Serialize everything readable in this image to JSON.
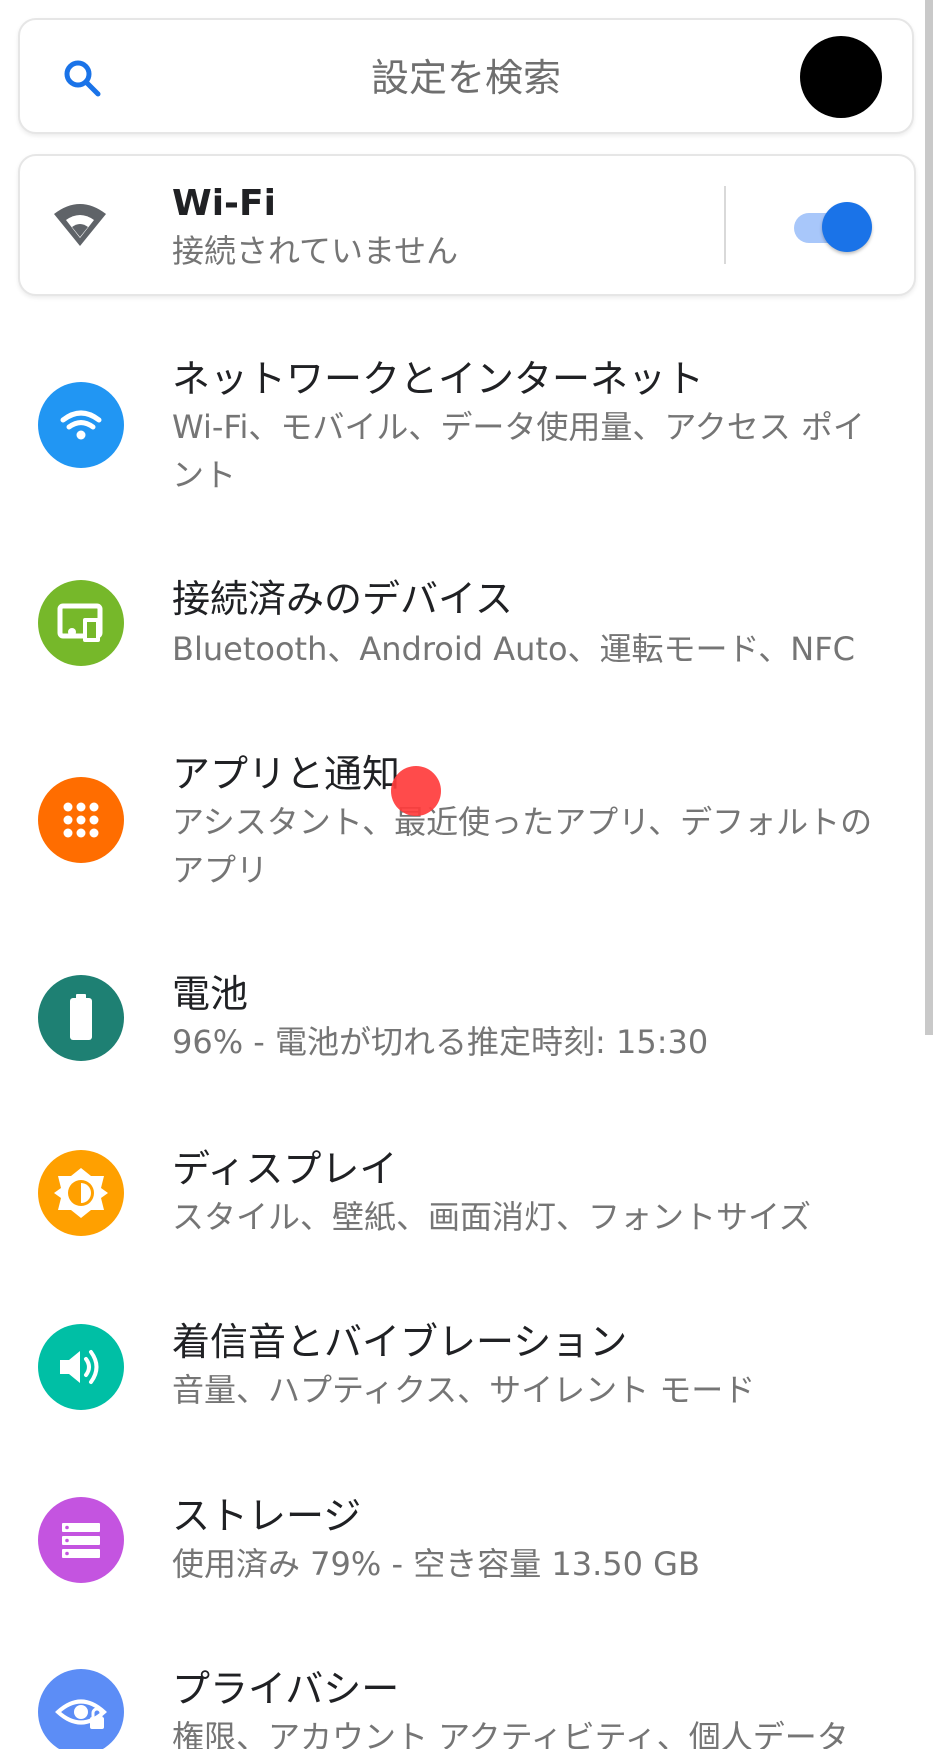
{
  "search": {
    "placeholder": "設定を検索"
  },
  "wifi": {
    "title": "Wi-Fi",
    "status": "接続されていません",
    "enabled": true
  },
  "items": [
    {
      "title": "ネットワークとインターネット",
      "subtitle": "Wi-Fi、モバイル、データ使用量、アクセス ポイント",
      "icon": "wifi-icon",
      "color": "#2196f3"
    },
    {
      "title": "接続済みのデバイス",
      "subtitle": "Bluetooth、Android Auto、運転モード、NFC",
      "icon": "devices-icon",
      "color": "#76b82a"
    },
    {
      "title": "アプリと通知",
      "subtitle": "アシスタント、最近使ったアプリ、デフォルトのアプリ",
      "icon": "apps-grid-icon",
      "color": "#ff6d00"
    },
    {
      "title": "電池",
      "subtitle": "96% - 電池が切れる推定時刻: 15:30",
      "icon": "battery-icon",
      "color": "#1e8073"
    },
    {
      "title": "ディスプレイ",
      "subtitle": "スタイル、壁紙、画面消灯、フォントサイズ",
      "icon": "brightness-icon",
      "color": "#ffa000"
    },
    {
      "title": "着信音とバイブレーション",
      "subtitle": "音量、ハプティクス、サイレント モード",
      "icon": "volume-icon",
      "color": "#00bfa5"
    },
    {
      "title": "ストレージ",
      "subtitle": "使用済み 79% - 空き容量 13.50 GB",
      "icon": "storage-icon",
      "color": "#c454e0"
    },
    {
      "title": "プライバシー",
      "subtitle": "権限、アカウント アクティビティ、個人データ",
      "icon": "privacy-eye-icon",
      "color": "#5c8df6"
    }
  ]
}
